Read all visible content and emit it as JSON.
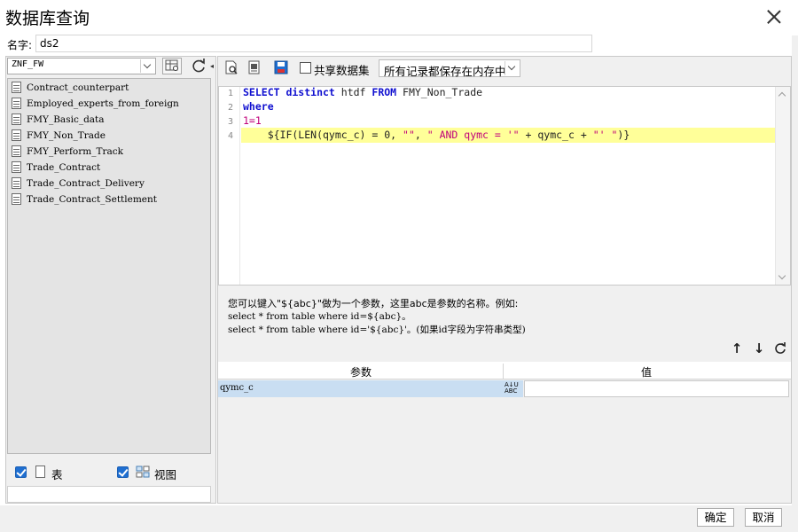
{
  "window": {
    "title": "数据库查询"
  },
  "name_row": {
    "label": "名字:",
    "value": "ds2"
  },
  "left": {
    "db_select": "ZNF_FW",
    "tables": [
      "Contract_counterpart",
      "Employed_experts_from_foreign",
      "FMY_Basic_data",
      "FMY_Non_Trade",
      "FMY_Perform_Track",
      "Trade_Contract",
      "Trade_Contract_Delivery",
      "Trade_Contract_Settlement"
    ],
    "show_table_label": "表",
    "show_view_label": "视图",
    "show_table_checked": true,
    "show_view_checked": true
  },
  "toolbar": {
    "shared_dataset_label": "共享数据集",
    "shared_dataset_checked": false,
    "memory_option": "所有记录都保存在内存中"
  },
  "editor": {
    "line_numbers": [
      "1",
      "2",
      "3",
      "4"
    ],
    "lines": [
      [
        {
          "t": "SELECT distinct",
          "c": "kw"
        },
        {
          "t": " htdf ",
          "c": "plain"
        },
        {
          "t": "FROM",
          "c": "kw"
        },
        {
          "t": " FMY_Non_Trade",
          "c": "plain"
        }
      ],
      [
        {
          "t": "where",
          "c": "kw"
        }
      ],
      [
        {
          "t": "1=1",
          "c": "kw2"
        }
      ],
      [
        {
          "t": "    ${IF(LEN(qymc_c) = 0, ",
          "c": "plain"
        },
        {
          "t": "\"\"",
          "c": "str"
        },
        {
          "t": ", ",
          "c": "plain"
        },
        {
          "t": "\" AND qymc = '\"",
          "c": "str"
        },
        {
          "t": " + qymc_c + ",
          "c": "plain"
        },
        {
          "t": "\"' \"",
          "c": "str"
        },
        {
          "t": ")}",
          "c": "plain"
        }
      ]
    ]
  },
  "hints": {
    "line1": "您可以键入\"${abc}\"做为一个参数，这里abc是参数的名称。例如:",
    "line2": "select * from table where id=${abc}。",
    "line3": "select * from table where id='${abc}'。(如果id字段为字符串类型)"
  },
  "params": {
    "col_param": "参数",
    "col_value": "值",
    "rows": [
      {
        "name": "qymc_c",
        "type_icon": "A↓U ABC",
        "value": ""
      }
    ]
  },
  "footer": {
    "ok": "确定",
    "cancel": "取消"
  },
  "icons": {
    "close": "close-icon",
    "refresh": "refresh-icon",
    "table": "table-icon",
    "view": "view-icon",
    "preview": "preview-icon",
    "save": "save-icon"
  }
}
